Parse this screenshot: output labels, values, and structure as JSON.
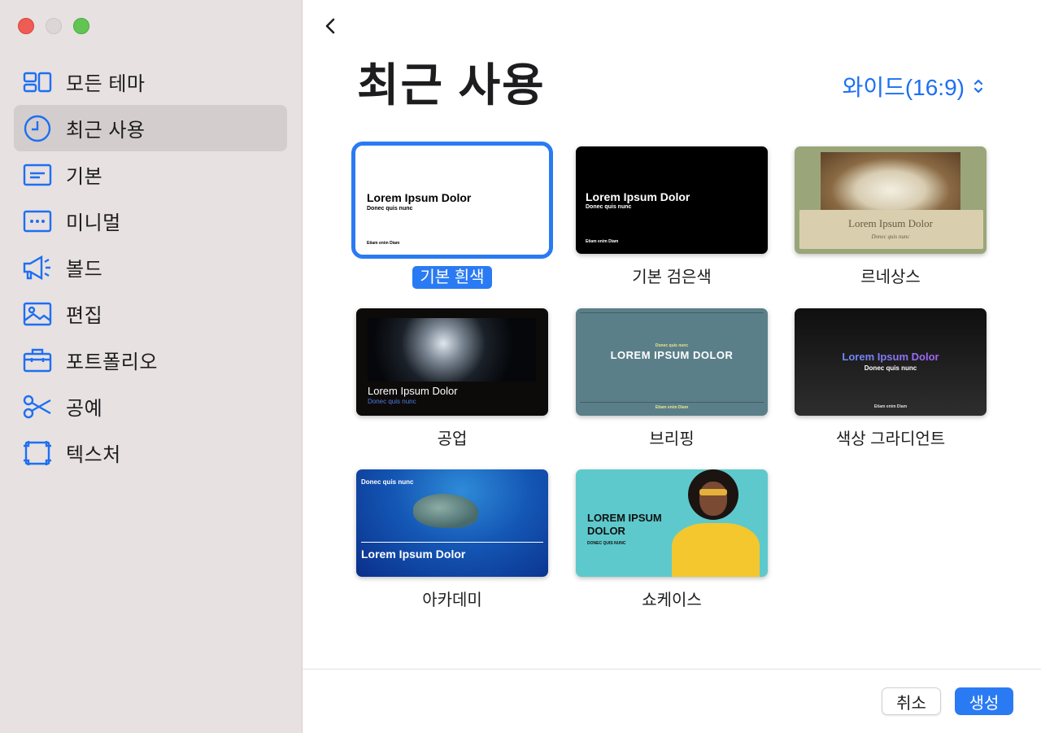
{
  "sidebar": {
    "items": [
      {
        "label": "모든 테마",
        "icon": "all-themes-icon"
      },
      {
        "label": "최근 사용",
        "icon": "clock-icon",
        "active": true
      },
      {
        "label": "기본",
        "icon": "basic-icon"
      },
      {
        "label": "미니멀",
        "icon": "minimal-icon"
      },
      {
        "label": "볼드",
        "icon": "megaphone-icon"
      },
      {
        "label": "편집",
        "icon": "photo-icon"
      },
      {
        "label": "포트폴리오",
        "icon": "briefcase-icon"
      },
      {
        "label": "공예",
        "icon": "scissors-icon"
      },
      {
        "label": "텍스처",
        "icon": "texture-icon"
      }
    ]
  },
  "header": {
    "title": "최근 사용",
    "aspect_ratio": "와이드(16:9)"
  },
  "themes": [
    {
      "name": "기본 흰색",
      "selected": true,
      "title": "Lorem Ipsum Dolor",
      "subtitle": "Donec quis nunc",
      "footer": "Etiam enim Diam"
    },
    {
      "name": "기본 검은색",
      "title": "Lorem Ipsum Dolor",
      "subtitle": "Donec quis nunc",
      "footer": "Etiam enim Diam"
    },
    {
      "name": "르네상스",
      "title": "Lorem Ipsum Dolor",
      "subtitle": "Donec quis nunc"
    },
    {
      "name": "공업",
      "title": "Lorem Ipsum Dolor",
      "subtitle": "Donec quis nunc"
    },
    {
      "name": "브리핑",
      "title": "LOREM IPSUM DOLOR",
      "subtitle": "Donec quis nunc",
      "footer": "Etiam enim Diam"
    },
    {
      "name": "색상 그라디언트",
      "title": "Lorem Ipsum Dolor",
      "subtitle": "Donec quis nunc",
      "footer": "Etiam enim Diam"
    },
    {
      "name": "아카데미",
      "title": "Lorem Ipsum Dolor",
      "subtitle": "Donec quis nunc"
    },
    {
      "name": "쇼케이스",
      "title": "LOREM IPSUM DOLOR",
      "subtitle": "DONEC QUIS NUNC"
    }
  ],
  "footer": {
    "cancel_label": "취소",
    "create_label": "생성"
  },
  "colors": {
    "accent": "#2a7bf3",
    "sidebar_bg": "#e7e1e1"
  }
}
